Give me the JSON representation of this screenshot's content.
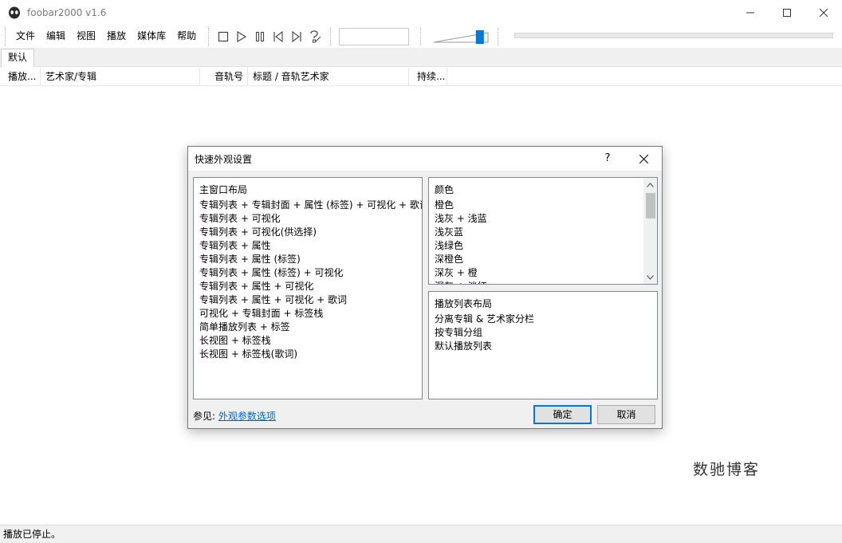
{
  "window": {
    "title": "foobar2000 v1.6",
    "controls": [
      "minimize-icon",
      "maximize-icon",
      "close-icon"
    ]
  },
  "menu": {
    "items": [
      "文件",
      "编辑",
      "视图",
      "播放",
      "媒体库",
      "帮助"
    ]
  },
  "toolbar": {
    "buttons": [
      "stop-icon",
      "play-icon",
      "pause-icon",
      "previous-icon",
      "next-icon",
      "random-icon"
    ],
    "seek_value": "",
    "volume_level": 0.85,
    "accent_color": "#0078d7"
  },
  "tabs": [
    "默认"
  ],
  "columns": [
    "播放...",
    "艺术家/专辑",
    "音轨号",
    "标题 / 音轨艺术家",
    "持续..."
  ],
  "status": "播放已停止。",
  "watermark": "数驰博客",
  "dialog": {
    "title": "快速外观设置",
    "help": "?",
    "layouts": {
      "header": "主窗口布局",
      "items": [
        "专辑列表 + 专辑封面 + 属性 (标签) + 可视化 + 歌词",
        "专辑列表 + 可视化",
        "专辑列表 + 可视化(供选择)",
        "专辑列表 + 属性",
        "专辑列表 + 属性 (标签)",
        "专辑列表 + 属性 (标签) + 可视化",
        "专辑列表 + 属性 + 可视化",
        "专辑列表 + 属性 + 可视化 + 歌词",
        "可视化 + 专辑封面 + 标签栈",
        "简单播放列表 + 标签",
        "长视图 + 标签栈",
        "长视图 + 标签栈(歌词)"
      ]
    },
    "colors": {
      "header": "颜色",
      "items": [
        "橙色",
        "浅灰 + 浅蓝",
        "浅灰蓝",
        "浅绿色",
        "深橙色",
        "深灰 + 橙",
        "深灰 + 淡红"
      ]
    },
    "playlist_layout": {
      "header": "播放列表布局",
      "items": [
        "分离专辑 & 艺术家分栏",
        "按专辑分组",
        "默认播放列表"
      ]
    },
    "see_also_label": "参见:",
    "see_also_link": "外观参数选项",
    "ok_label": "确定",
    "cancel_label": "取消"
  }
}
